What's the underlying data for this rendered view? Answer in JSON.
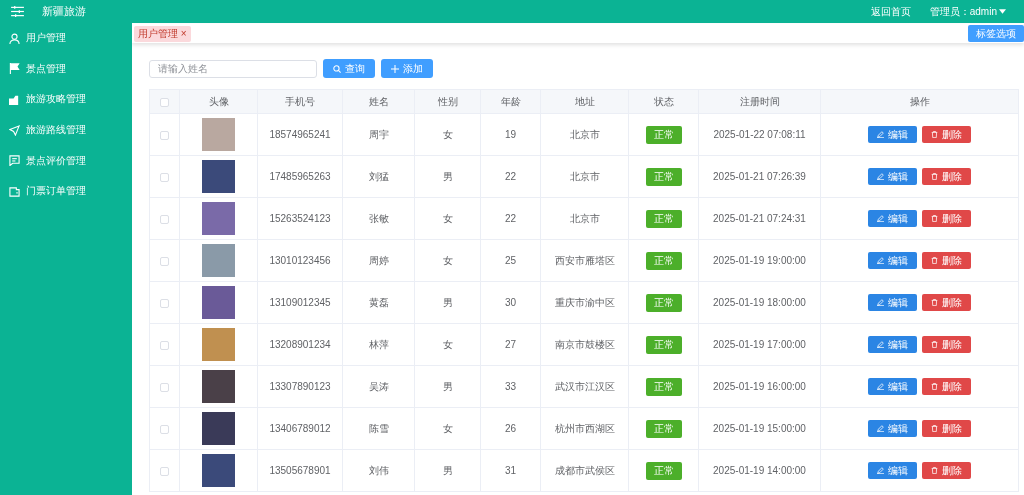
{
  "header": {
    "title": "新疆旅游",
    "home_link": "返回首页",
    "user_label": "管理员：",
    "user_name": "admin"
  },
  "sidebar": {
    "items": [
      {
        "label": "用户管理"
      },
      {
        "label": "景点管理"
      },
      {
        "label": "旅游攻略管理"
      },
      {
        "label": "旅游路线管理"
      },
      {
        "label": "景点评价管理"
      },
      {
        "label": "门票订单管理"
      }
    ]
  },
  "tags": {
    "items": [
      {
        "label": "用户管理",
        "close": "×",
        "selected": true
      }
    ],
    "options_button": "标签选项"
  },
  "toolbar": {
    "search": {
      "placeholder": "请输入姓名"
    },
    "search_button": "查询",
    "add_button": "添加"
  },
  "table": {
    "header_checked": false,
    "columns": [
      "头像",
      "手机号",
      "姓名",
      "性别",
      "年龄",
      "地址",
      "状态",
      "注册时间",
      "操作"
    ],
    "rows": [
      {
        "checked": false,
        "phone": "18574965241",
        "name": "周宇",
        "gender": "女",
        "age": "19",
        "address": "北京市",
        "status": "正常",
        "time": "2025-01-22 07:08:11",
        "edit": "编辑",
        "delete": "删除"
      },
      {
        "checked": false,
        "phone": "17485965263",
        "name": "刘猛",
        "gender": "男",
        "age": "22",
        "address": "北京市",
        "status": "正常",
        "time": "2025-01-21 07:26:39",
        "edit": "编辑",
        "delete": "删除"
      },
      {
        "checked": false,
        "phone": "15263524123",
        "name": "张敏",
        "gender": "女",
        "age": "22",
        "address": "北京市",
        "status": "正常",
        "time": "2025-01-21 07:24:31",
        "edit": "编辑",
        "delete": "删除"
      },
      {
        "checked": false,
        "phone": "13010123456",
        "name": "周婷",
        "gender": "女",
        "age": "25",
        "address": "西安市雁塔区",
        "status": "正常",
        "time": "2025-01-19 19:00:00",
        "edit": "编辑",
        "delete": "删除"
      },
      {
        "checked": false,
        "phone": "13109012345",
        "name": "黄磊",
        "gender": "男",
        "age": "30",
        "address": "重庆市渝中区",
        "status": "正常",
        "time": "2025-01-19 18:00:00",
        "edit": "编辑",
        "delete": "删除"
      },
      {
        "checked": false,
        "phone": "13208901234",
        "name": "林萍",
        "gender": "女",
        "age": "27",
        "address": "南京市鼓楼区",
        "status": "正常",
        "time": "2025-01-19 17:00:00",
        "edit": "编辑",
        "delete": "删除"
      },
      {
        "checked": false,
        "phone": "13307890123",
        "name": "吴涛",
        "gender": "男",
        "age": "33",
        "address": "武汉市江汉区",
        "status": "正常",
        "time": "2025-01-19 16:00:00",
        "edit": "编辑",
        "delete": "删除"
      },
      {
        "checked": false,
        "phone": "13406789012",
        "name": "陈雪",
        "gender": "女",
        "age": "26",
        "address": "杭州市西湖区",
        "status": "正常",
        "time": "2025-01-19 15:00:00",
        "edit": "编辑",
        "delete": "删除"
      },
      {
        "checked": false,
        "phone": "13505678901",
        "name": "刘伟",
        "gender": "男",
        "age": "31",
        "address": "成都市武侯区",
        "status": "正常",
        "time": "2025-01-19 14:00:00",
        "edit": "编辑",
        "delete": "删除"
      }
    ]
  }
}
